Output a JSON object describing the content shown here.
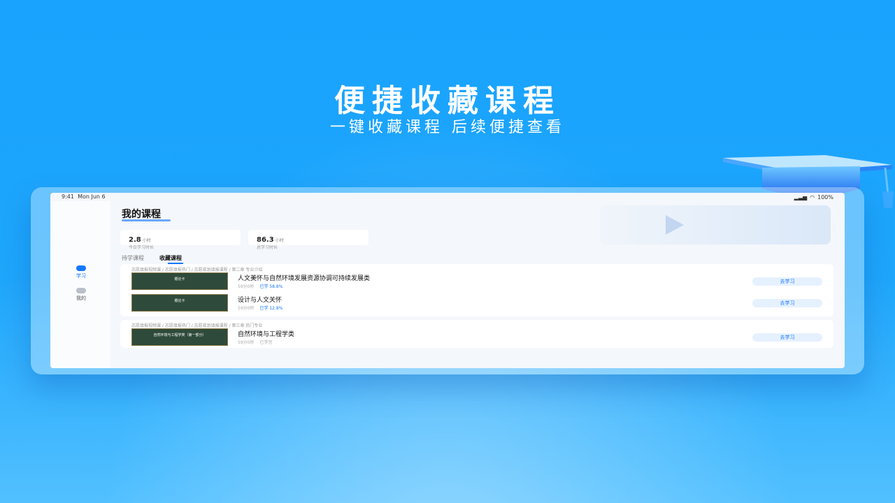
{
  "colors": {
    "accent": "#1677ff",
    "background": "#1ea6fb",
    "button_bg": "#e6f1ff"
  },
  "headline": "便捷收藏课程",
  "subline": "一键收藏课程 后续便捷查看",
  "status_bar": {
    "time": "9:41",
    "date": "Mon Jun 6",
    "battery": "100%"
  },
  "sidebar": {
    "items": [
      {
        "label": "学习",
        "icon": "study-icon",
        "active": true
      },
      {
        "label": "我的",
        "icon": "profile-icon",
        "active": false
      }
    ]
  },
  "page_title": "我的课程",
  "stats": [
    {
      "value": "2.8",
      "unit": "小时",
      "label": "今日学习时长"
    },
    {
      "value": "86.3",
      "unit": "小时",
      "label": "总学习时长"
    }
  ],
  "tabs": [
    {
      "label": "待学课程",
      "active": false
    },
    {
      "label": "收藏课程",
      "active": true
    }
  ],
  "groups": [
    {
      "breadcrumb": "志愿填报视频课 / 志愿填报热门 / 志愿规划填报课程 / 第二章 专业介绍",
      "courses": [
        {
          "thumb_title": "概论卡",
          "title": "人文美怀与自然环境发展资源协调可持续发展类",
          "duration": "59分0秒",
          "progress": "已学 58.8%",
          "button": "去学习"
        },
        {
          "thumb_title": "概论卡",
          "title": "设计与人文关怀",
          "duration": "59分0秒",
          "progress": "已学 12.8%",
          "button": "去学习"
        }
      ]
    },
    {
      "breadcrumb": "志愿填报视频课 / 志愿填报热门 / 志愿规划填报课程 / 第三章 热门专业",
      "courses": [
        {
          "thumb_title": "自然环境与工程学类（第一部分）",
          "title": "自然环境与工程学类",
          "duration": "59分0秒",
          "progress": "已学完",
          "button": "去学习"
        }
      ]
    }
  ]
}
